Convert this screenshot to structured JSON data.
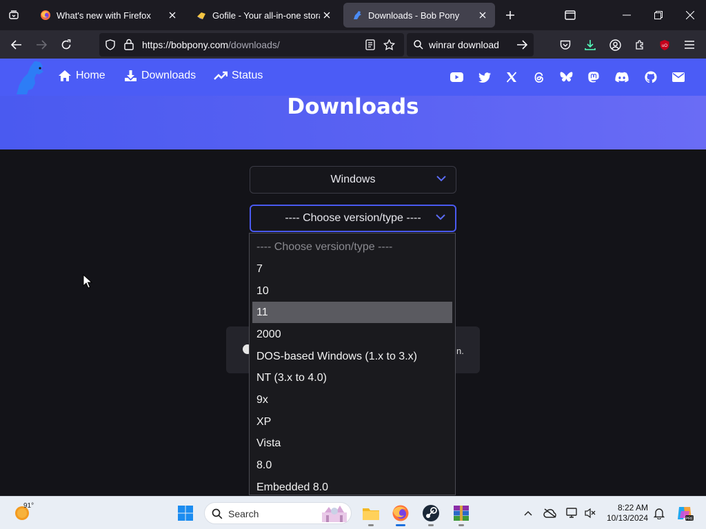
{
  "browser": {
    "tabs": [
      {
        "title": "What's new with Firefox",
        "icon": "firefox-icon",
        "active": false
      },
      {
        "title": "Gofile - Your all-in-one storage",
        "icon": "gofile-icon",
        "active": false
      },
      {
        "title": "Downloads - Bob Pony",
        "icon": "bobpony-icon",
        "active": true
      }
    ],
    "url_host": "https://bobpony.com",
    "url_path": "/downloads/",
    "search_query": "winrar download"
  },
  "site": {
    "nav": [
      {
        "label": "Home",
        "icon": "home-icon"
      },
      {
        "label": "Downloads",
        "icon": "download-icon"
      },
      {
        "label": "Status",
        "icon": "status-icon"
      }
    ],
    "social_icons": [
      "youtube-icon",
      "twitter-icon",
      "x-icon",
      "threads-icon",
      "bluesky-icon",
      "mastodon-icon",
      "discord-icon",
      "github-icon",
      "mail-icon"
    ],
    "page_title": "Downloads",
    "os_select_value": "Windows",
    "version_select_value": "---- Choose version/type ----",
    "info_tail": "n.",
    "dropdown_options": [
      "---- Choose version/type ----",
      "7",
      "10",
      "11",
      "2000",
      "DOS-based Windows (1.x to 3.x)",
      "NT (3.x to 4.0)",
      "9x",
      "XP",
      "Vista",
      "8.0",
      "Embedded 8.0"
    ],
    "highlighted_option": "11"
  },
  "taskbar": {
    "weather_temp": "91°",
    "search_label": "Search",
    "time": "8:22 AM",
    "date": "10/13/2024",
    "apps": [
      "windows-start-icon",
      "file-explorer-icon",
      "firefox-icon",
      "steam-icon",
      "winrar-icon"
    ]
  },
  "colors": {
    "accent": "#4b5cf6",
    "browser_dark": "#1c1b22",
    "page_bg": "#131318"
  }
}
